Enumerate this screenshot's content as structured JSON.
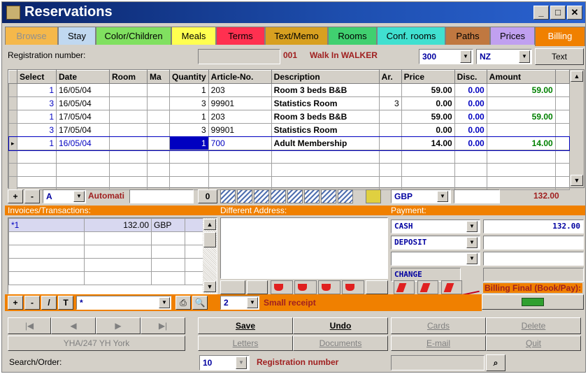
{
  "window": {
    "title": "Reservations",
    "min": "_",
    "max": "□",
    "close": "✕"
  },
  "tabs": [
    {
      "label": "Browse",
      "bg": "#f5b84a",
      "fg": "#909090"
    },
    {
      "label": "Stay",
      "bg": "#c0d8f0",
      "fg": "#000"
    },
    {
      "label": "Color/Children",
      "bg": "#80e060",
      "fg": "#000"
    },
    {
      "label": "Meals",
      "bg": "#ffff50",
      "fg": "#000"
    },
    {
      "label": "Terms",
      "bg": "#ff3050",
      "fg": "#000"
    },
    {
      "label": "Text/Memo",
      "bg": "#d8a020",
      "fg": "#000"
    },
    {
      "label": "Rooms",
      "bg": "#40d070",
      "fg": "#000"
    },
    {
      "label": "Conf. rooms",
      "bg": "#40e0d0",
      "fg": "#000"
    },
    {
      "label": "Paths",
      "bg": "#c07840",
      "fg": "#000"
    },
    {
      "label": "Prices",
      "bg": "#c0a0f0",
      "fg": "#000"
    },
    {
      "label": "Billing",
      "bg": "#f08000",
      "fg": "#fff"
    }
  ],
  "header": {
    "reg_label": "Registration number:",
    "reg_value": "001",
    "guest": "Walk In WALKER",
    "code": "300",
    "country": "NZ",
    "text_button": "Text"
  },
  "grid": {
    "columns": [
      "Select",
      "Date",
      "Room",
      "Ma",
      "Quantity",
      "Article-No.",
      "Description",
      "Ar.",
      "Price",
      "Disc.",
      "Amount"
    ],
    "rows": [
      {
        "select": "1",
        "date": "16/05/04",
        "room": "",
        "ma": "",
        "qty": "1",
        "article": "203",
        "desc": "Room 3 beds B&B",
        "ar": "",
        "price": "59.00",
        "disc": "0.00",
        "amount": "59.00"
      },
      {
        "select": "3",
        "date": "16/05/04",
        "room": "",
        "ma": "",
        "qty": "3",
        "article": "99901",
        "desc": "Statistics Room",
        "ar": "3",
        "price": "0.00",
        "disc": "0.00",
        "amount": ""
      },
      {
        "select": "1",
        "date": "17/05/04",
        "room": "",
        "ma": "",
        "qty": "1",
        "article": "203",
        "desc": "Room 3 beds B&B",
        "ar": "",
        "price": "59.00",
        "disc": "0.00",
        "amount": "59.00"
      },
      {
        "select": "3",
        "date": "17/05/04",
        "room": "",
        "ma": "",
        "qty": "3",
        "article": "99901",
        "desc": "Statistics Room",
        "ar": "",
        "price": "0.00",
        "disc": "0.00",
        "amount": ""
      },
      {
        "select": "1",
        "date": "16/05/04",
        "room": "",
        "ma": "",
        "qty": "1",
        "article": "700",
        "desc": "Adult Membership",
        "ar": "",
        "price": "14.00",
        "disc": "0.00",
        "amount": "14.00"
      }
    ],
    "current_row_marker": "▸"
  },
  "gridtools": {
    "plus": "+",
    "minus": "-",
    "mode": "A",
    "auto_label": "Automati",
    "zero": "0",
    "currency": "GBP",
    "total": "132.00"
  },
  "invoices": {
    "title": "Invoices/Transactions:",
    "rows": [
      {
        "id": "*1",
        "amount": "132.00",
        "currency": "GBP"
      }
    ],
    "plus": "+",
    "minus": "-",
    "slash": "/",
    "t": "T",
    "filter": "*"
  },
  "address": {
    "title": "Different Address:"
  },
  "payment": {
    "title": "Payment:",
    "methods": [
      {
        "name": "CASH",
        "amount": "132.00"
      },
      {
        "name": "DEPOSIT",
        "amount": ""
      },
      {
        "name": "",
        "amount": ""
      }
    ],
    "change_label": "CHANGE",
    "billing_final": "Billing Final (Book/Pay):"
  },
  "receipt": {
    "count": "2",
    "label": "Small receipt"
  },
  "nav": {
    "first": "|◀",
    "prev": "◀",
    "next": "▶",
    "last": "▶|",
    "location": "YHA/247 YH York"
  },
  "actions": {
    "save": "Save",
    "undo": "Undo",
    "cards": "Cards",
    "delete": "Delete",
    "letters": "Letters",
    "documents": "Documents",
    "email": "E-mail",
    "quit": "Quit"
  },
  "search": {
    "label": "Search/Order:",
    "value": "10",
    "order": "Registration number"
  }
}
